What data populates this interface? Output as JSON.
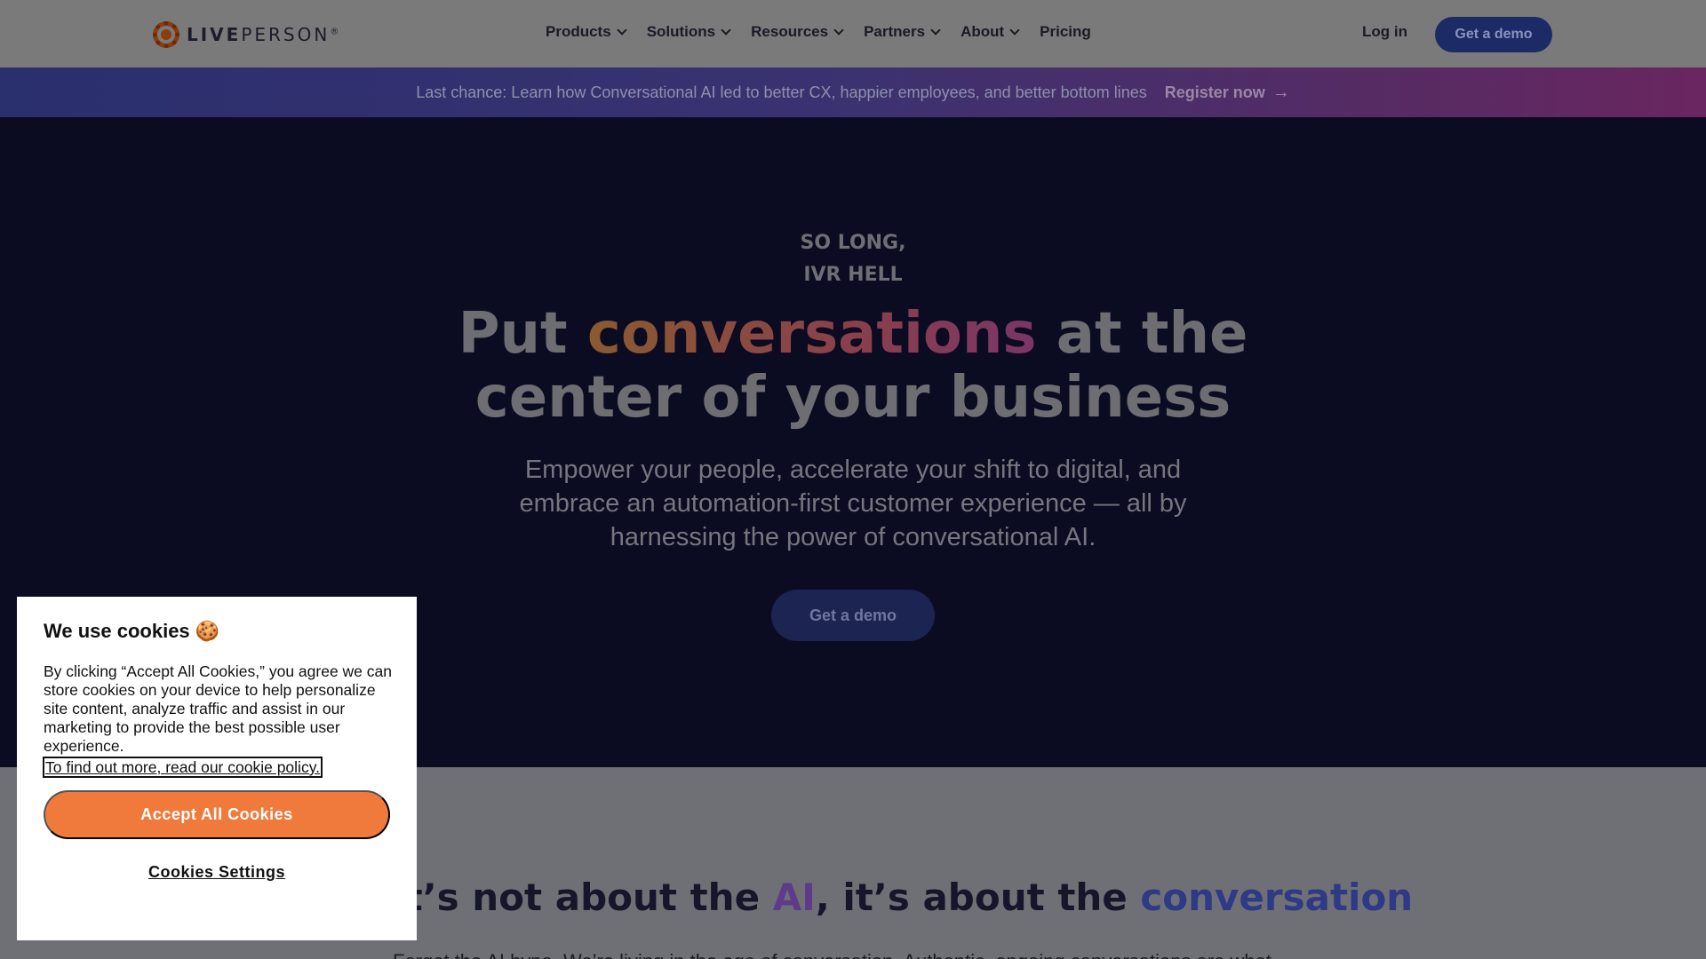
{
  "header": {
    "logo": {
      "bold": "LIVE",
      "rest": "PERSON",
      "mark": "®"
    },
    "nav": [
      {
        "label": "Products",
        "has_dropdown": true
      },
      {
        "label": "Solutions",
        "has_dropdown": true
      },
      {
        "label": "Resources",
        "has_dropdown": true
      },
      {
        "label": "Partners",
        "has_dropdown": true
      },
      {
        "label": "About",
        "has_dropdown": true
      },
      {
        "label": "Pricing",
        "has_dropdown": false
      }
    ],
    "login_label": "Log in",
    "demo_label": "Get a demo"
  },
  "banner": {
    "text": "Last chance: Learn how Conversational AI led to better CX, happier employees, and better bottom lines",
    "link_label": "Register now",
    "link_icon": "→"
  },
  "hero": {
    "eyebrow_line1": "SO LONG,",
    "eyebrow_line2": "IVR HELL",
    "title_before": "Put ",
    "title_highlight": "conversations",
    "title_after": " at the center of your business",
    "subtitle": "Empower your people, accelerate your shift to digital, and embrace an automation-first customer experience — all by harnessing the power of conversational AI.",
    "cta_label": "Get a demo"
  },
  "section": {
    "title_p1": "It’s not about the ",
    "title_ai": "AI",
    "title_p2": ", it’s about the ",
    "title_conv": "conversation",
    "body_start": "Forget the AI hype. We’re living in the age of conversation. Authentic, ongoing conversations are what"
  },
  "cookie": {
    "title": "We use cookies 🍪",
    "body": "By clicking “Accept All Cookies,” you agree we can store cookies on your device to help personalize site content, analyze traffic and assist in our marketing to provide the best possible user experience.",
    "policy_link": "To find out more, read our cookie policy.",
    "accept_label": "Accept All Cookies",
    "settings_label": "Cookies Settings"
  },
  "colors": {
    "header_bg": "#7a7a7a",
    "hero_bg": "#0b0b22",
    "accent_orange": "#f07a3c",
    "demo_button": "#1c2a66"
  }
}
